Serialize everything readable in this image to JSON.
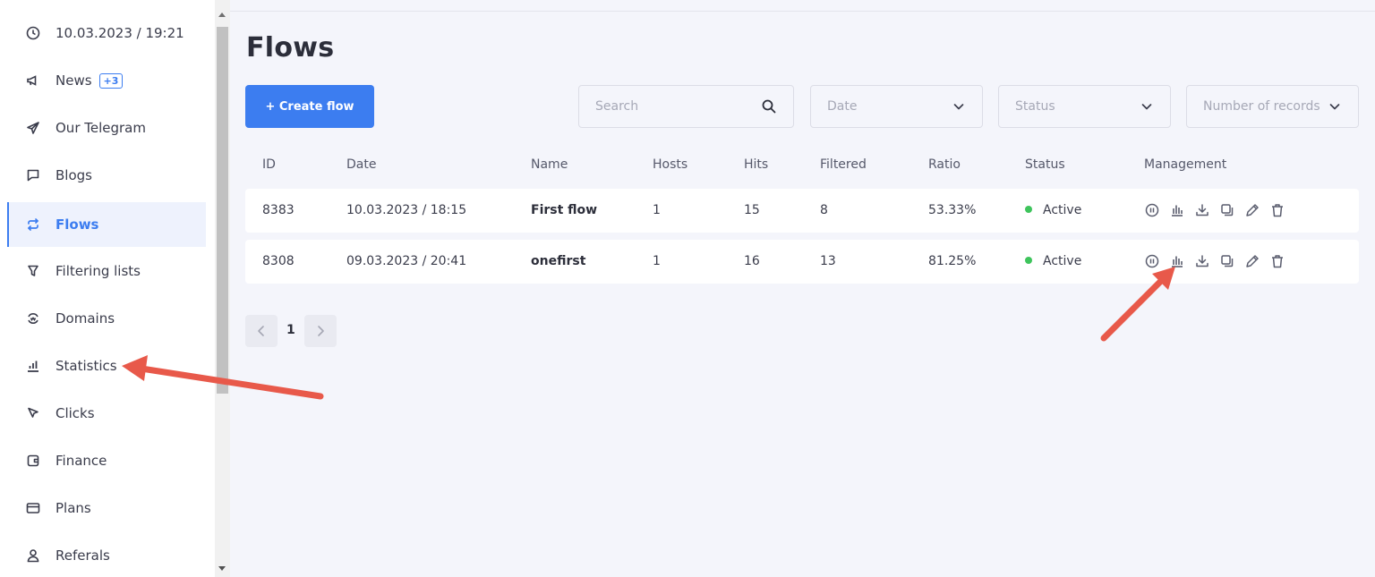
{
  "sidebar": {
    "items": [
      {
        "label": "10.03.2023 / 19:21",
        "icon": "clock-icon"
      },
      {
        "label": "News",
        "icon": "megaphone-icon",
        "badge": "+3"
      },
      {
        "label": "Our Telegram",
        "icon": "telegram-icon"
      },
      {
        "label": "Blogs",
        "icon": "message-square-icon"
      },
      {
        "label": "Flows",
        "icon": "repeat-icon",
        "active": true
      },
      {
        "label": "Filtering lists",
        "icon": "filter-icon"
      },
      {
        "label": "Domains",
        "icon": "globe-icon"
      },
      {
        "label": "Statistics",
        "icon": "bar-chart-icon"
      },
      {
        "label": "Clicks",
        "icon": "cursor-icon"
      },
      {
        "label": "Finance",
        "icon": "wallet-icon"
      },
      {
        "label": "Plans",
        "icon": "credit-card-icon"
      },
      {
        "label": "Referals",
        "icon": "user-icon"
      }
    ]
  },
  "main": {
    "title": "Flows",
    "create_label": "+ Create flow",
    "search_placeholder": "Search",
    "filters": {
      "date": "Date",
      "status": "Status",
      "records": "Number of records"
    },
    "columns": [
      "ID",
      "Date",
      "Name",
      "Hosts",
      "Hits",
      "Filtered",
      "Ratio",
      "Status",
      "Management"
    ],
    "rows": [
      {
        "id": "8383",
        "date": "10.03.2023 / 18:15",
        "name": "First flow",
        "hosts": "1",
        "hits": "15",
        "filtered": "8",
        "ratio": "53.33%",
        "status": "Active"
      },
      {
        "id": "8308",
        "date": "09.03.2023 / 20:41",
        "name": "onefirst",
        "hosts": "1",
        "hits": "16",
        "filtered": "13",
        "ratio": "81.25%",
        "status": "Active"
      }
    ],
    "management_icons": [
      "pause-icon",
      "stats-icon",
      "download-icon",
      "copy-icon",
      "edit-icon",
      "trash-icon"
    ],
    "pagination": {
      "current": "1"
    }
  },
  "colors": {
    "accent": "#3c7df0",
    "active_status": "#3ec45c",
    "annotation_arrow": "#e8594a"
  }
}
